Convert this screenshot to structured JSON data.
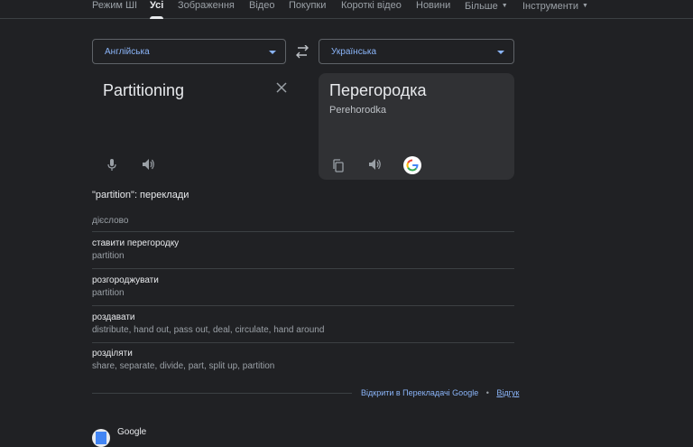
{
  "tabs": [
    {
      "label": "Режим ШІ"
    },
    {
      "label": "Усі"
    },
    {
      "label": "Зображення"
    },
    {
      "label": "Відео"
    },
    {
      "label": "Покупки"
    },
    {
      "label": "Короткі відео"
    },
    {
      "label": "Новини"
    },
    {
      "label": "Більше"
    },
    {
      "label": "Інструменти"
    }
  ],
  "source_language": "Англійська",
  "target_language": "Українська",
  "source_text": "Partitioning",
  "translation": "Перегородка",
  "transliteration": "Perehorodka",
  "dictionary": {
    "title": "\"partition\": переклади",
    "part_of_speech": "дієслово",
    "entries": [
      {
        "word": "ставити перегородку",
        "synonyms": "partition"
      },
      {
        "word": "розгороджувати",
        "synonyms": "partition"
      },
      {
        "word": "роздавати",
        "synonyms": "distribute, hand out, pass out, deal, circulate, hand around"
      },
      {
        "word": "розділяти",
        "synonyms": "share, separate, divide, part, split up, partition"
      }
    ]
  },
  "footer": {
    "open_link": "Відкрити в Перекладачі Google",
    "separator": "•",
    "feedback": "Відгук"
  },
  "next_result": {
    "site": "Google"
  },
  "colors": {
    "background": "#202124",
    "accent": "#8ab4f8",
    "panel": "#303134"
  },
  "icons": [
    "mic-icon",
    "speaker-icon",
    "copy-icon",
    "google-logo-icon",
    "close-icon",
    "swap-icon"
  ]
}
